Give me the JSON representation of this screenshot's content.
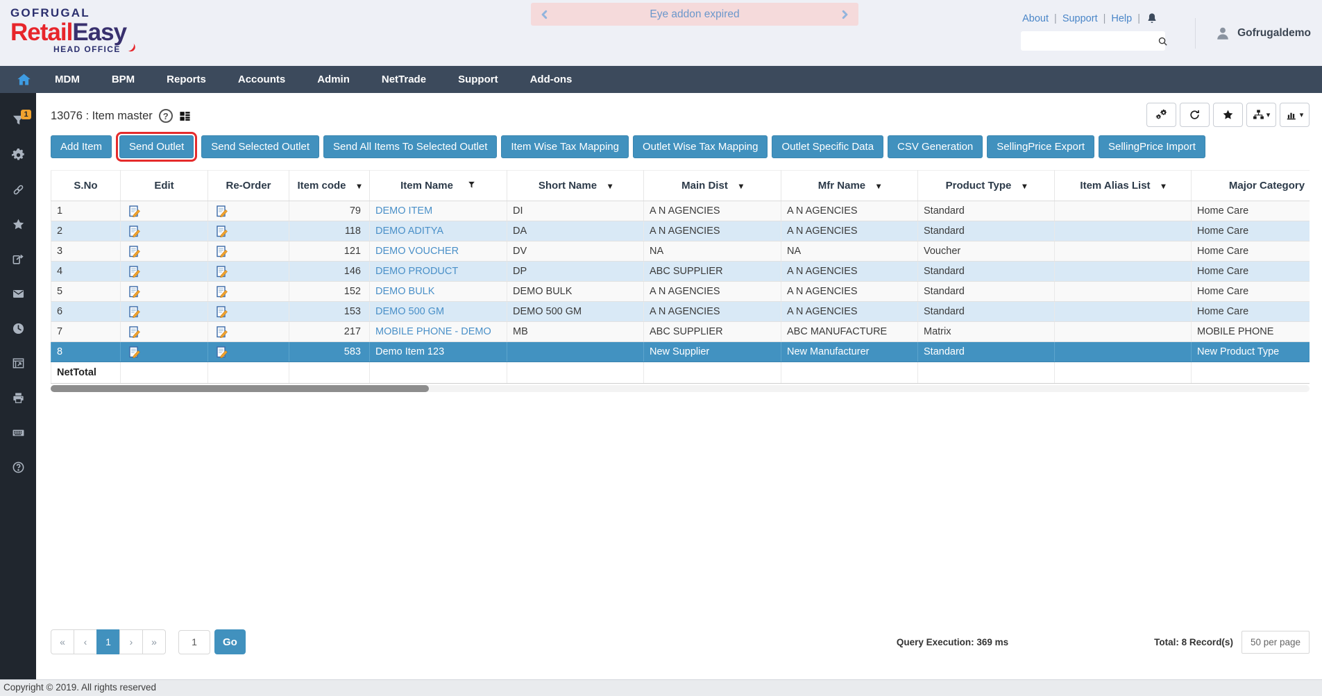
{
  "header": {
    "logo": {
      "brand": "GOFRUGAL",
      "product_red": "Retail",
      "product_navy": "Easy",
      "suffix": "HEAD OFFICE"
    },
    "banner": {
      "text": "Eye addon expired"
    },
    "links": {
      "about": "About",
      "support": "Support",
      "help": "Help"
    },
    "user": "Gofrugaldemo"
  },
  "nav": {
    "items": [
      "MDM",
      "BPM",
      "Reports",
      "Accounts",
      "Admin",
      "NetTrade",
      "Support",
      "Add-ons"
    ]
  },
  "sidebar": {
    "items": [
      {
        "name": "filter-icon",
        "icon": "filter",
        "badge": "1"
      },
      {
        "name": "settings-gear-icon",
        "icon": "gear"
      },
      {
        "name": "link-icon",
        "icon": "link"
      },
      {
        "name": "favorites-star-icon",
        "icon": "star"
      },
      {
        "name": "share-export-icon",
        "icon": "share"
      },
      {
        "name": "mail-icon",
        "icon": "mail"
      },
      {
        "name": "history-clock-icon",
        "icon": "clock"
      },
      {
        "name": "window-restore-icon",
        "icon": "window"
      },
      {
        "name": "print-icon",
        "icon": "printer"
      },
      {
        "name": "keyboard-icon",
        "icon": "keyboard"
      },
      {
        "name": "help-circle-icon",
        "icon": "help"
      }
    ]
  },
  "page": {
    "title": "13076 : Item master",
    "view_tools": [
      {
        "name": "settings-gears-button",
        "icon": "gears",
        "caret": false
      },
      {
        "name": "refresh-button",
        "icon": "refresh",
        "caret": false
      },
      {
        "name": "favorite-star-button",
        "icon": "star",
        "caret": false
      },
      {
        "name": "hierarchy-view-button",
        "icon": "sitemap",
        "caret": true
      },
      {
        "name": "chart-view-button",
        "icon": "chart",
        "caret": true
      }
    ],
    "toolbar": [
      {
        "label": "Add Item",
        "highlighted": false
      },
      {
        "label": "Send Outlet",
        "highlighted": true
      },
      {
        "label": "Send Selected Outlet",
        "highlighted": false
      },
      {
        "label": "Send All Items To Selected Outlet",
        "highlighted": false
      },
      {
        "label": "Item Wise Tax Mapping",
        "highlighted": false
      },
      {
        "label": "Outlet Wise Tax Mapping",
        "highlighted": false
      },
      {
        "label": "Outlet Specific Data",
        "highlighted": false
      },
      {
        "label": "CSV Generation",
        "highlighted": false
      },
      {
        "label": "SellingPrice Export",
        "highlighted": false
      },
      {
        "label": "SellingPrice Import",
        "highlighted": false
      }
    ],
    "table": {
      "columns": [
        {
          "label": "S.No",
          "caret": false,
          "filter": false
        },
        {
          "label": "Edit",
          "caret": false,
          "filter": false
        },
        {
          "label": "Re-Order",
          "caret": false,
          "filter": false
        },
        {
          "label": "Item code",
          "caret": true,
          "filter": false
        },
        {
          "label": "Item Name",
          "caret": false,
          "filter": true
        },
        {
          "label": "Short Name",
          "caret": true,
          "filter": false
        },
        {
          "label": "Main Dist",
          "caret": true,
          "filter": false
        },
        {
          "label": "Mfr Name",
          "caret": true,
          "filter": false
        },
        {
          "label": "Product Type",
          "caret": true,
          "filter": false
        },
        {
          "label": "Item Alias List",
          "caret": true,
          "filter": false
        },
        {
          "label": "Major Category",
          "caret": true,
          "filter": false
        }
      ],
      "rows": [
        {
          "sno": "1",
          "item_code": "79",
          "item_name": "DEMO ITEM",
          "short_name": "DI",
          "main_dist": "A N AGENCIES",
          "mfr_name": "A N AGENCIES",
          "product_type": "Standard",
          "item_alias": "",
          "major_category": "Home Care",
          "selected": false
        },
        {
          "sno": "2",
          "item_code": "118",
          "item_name": "DEMO ADITYA",
          "short_name": "DA",
          "main_dist": "A N AGENCIES",
          "mfr_name": "A N AGENCIES",
          "product_type": "Standard",
          "item_alias": "",
          "major_category": "Home Care",
          "selected": false
        },
        {
          "sno": "3",
          "item_code": "121",
          "item_name": "DEMO VOUCHER",
          "short_name": "DV",
          "main_dist": "NA",
          "mfr_name": "NA",
          "product_type": "Voucher",
          "item_alias": "",
          "major_category": "Home Care",
          "selected": false
        },
        {
          "sno": "4",
          "item_code": "146",
          "item_name": "DEMO PRODUCT",
          "short_name": "DP",
          "main_dist": "ABC SUPPLIER",
          "mfr_name": "A N AGENCIES",
          "product_type": "Standard",
          "item_alias": "",
          "major_category": "Home Care",
          "selected": false
        },
        {
          "sno": "5",
          "item_code": "152",
          "item_name": "DEMO BULK",
          "short_name": "DEMO BULK",
          "main_dist": "A N AGENCIES",
          "mfr_name": "A N AGENCIES",
          "product_type": "Standard",
          "item_alias": "",
          "major_category": "Home Care",
          "selected": false
        },
        {
          "sno": "6",
          "item_code": "153",
          "item_name": "DEMO 500 GM",
          "short_name": "DEMO 500 GM",
          "main_dist": "A N AGENCIES",
          "mfr_name": "A N AGENCIES",
          "product_type": "Standard",
          "item_alias": "",
          "major_category": "Home Care",
          "selected": false
        },
        {
          "sno": "7",
          "item_code": "217",
          "item_name": "MOBILE PHONE - DEMO",
          "short_name": "MB",
          "main_dist": "ABC SUPPLIER",
          "mfr_name": "ABC MANUFACTURE",
          "product_type": "Matrix",
          "item_alias": "",
          "major_category": "MOBILE PHONE",
          "selected": false
        },
        {
          "sno": "8",
          "item_code": "583",
          "item_name": "Demo Item 123",
          "short_name": "",
          "main_dist": "New Supplier",
          "mfr_name": "New Manufacturer",
          "product_type": "Standard",
          "item_alias": "",
          "major_category": "New Product Type",
          "selected": true
        }
      ],
      "net_total_label": "NetTotal"
    },
    "pagination": {
      "buttons": [
        {
          "label": "«",
          "name": "first-page-button",
          "active": false
        },
        {
          "label": "‹",
          "name": "prev-page-button",
          "active": false
        },
        {
          "label": "1",
          "name": "page-1-button",
          "active": true
        },
        {
          "label": "›",
          "name": "next-page-button",
          "active": false
        },
        {
          "label": "»",
          "name": "last-page-button",
          "active": false
        }
      ],
      "goto_value": "1",
      "go_label": "Go"
    },
    "status": {
      "query_execution": "Query Execution: 369 ms",
      "total": "Total: 8 Record(s)",
      "per_page": "50 per page"
    }
  },
  "footer": {
    "copyright": "Copyright © 2019. All rights reserved"
  },
  "colors": {
    "accent_blue": "#4191be",
    "nav_dark": "#3c4a5c",
    "sidebar_dark": "#20262e",
    "selected_row": "#4292c1",
    "row_alt": "#d9e9f6",
    "banner_pink": "#f5dadb",
    "highlight_red": "#e52b2b",
    "link_blue": "#4a86c8",
    "badge_orange": "#f0a22e"
  }
}
